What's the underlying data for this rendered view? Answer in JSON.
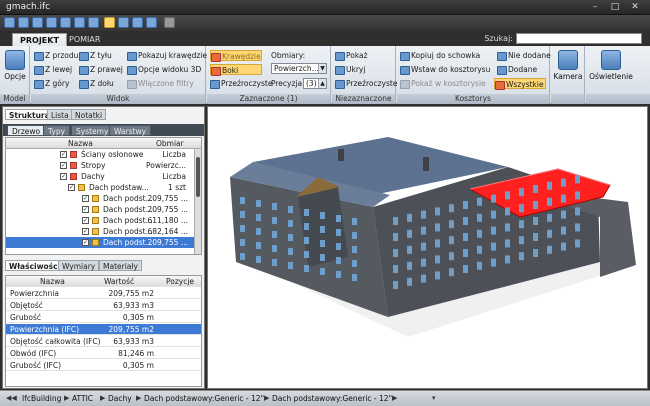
{
  "window": {
    "title": "gmach.ifc",
    "min": "–",
    "max": "□",
    "close": "✕"
  },
  "tabs": [
    "PROJEKT",
    "POMIAR"
  ],
  "search": {
    "label": "Szukaj:",
    "value": ""
  },
  "ribbon": {
    "model": {
      "button": "Opcje",
      "group": "Model"
    },
    "widok": {
      "group": "Widok",
      "items": [
        "Z przodu",
        "Z tyłu",
        "Z lewej",
        "Z prawej",
        "Z góry",
        "Z dołu"
      ],
      "edges": "Pokazuj krawędzie",
      "options3d": "Opcje widoku 3D",
      "filters": "Włączone filtry"
    },
    "zaznaczone": {
      "group": "Zaznaczone (1)",
      "items": [
        "Krawędzie",
        "Boki",
        "Przeźroczyste"
      ],
      "obmiary_label": "Obmiary:",
      "obmiary_value": "Powierzch...",
      "precyzja_label": "Precyzja",
      "precyzja_value": "(3)"
    },
    "niezaznaczone": {
      "group": "Niezaznaczone",
      "items": [
        "Pokaż",
        "Ukryj",
        "Przeźroczyste"
      ]
    },
    "kosztorys": {
      "group": "Kosztorys",
      "items": [
        "Kopiuj do schowka",
        "Wstaw do kosztorysu",
        "Pokaż w kosztorysie"
      ],
      "right": [
        "Nie dodane",
        "Dodane",
        "Wszystkie"
      ]
    },
    "camera": "Kamera",
    "lighting": "Oświetlenie"
  },
  "leftpane": {
    "tabs": [
      "Struktura",
      "Lista",
      "Notatki"
    ],
    "subtabs": [
      "Drzewo",
      "Typy",
      "Systemy",
      "Warstwy"
    ],
    "tree_headers": [
      "Nazwa",
      "Obmiar"
    ],
    "tree_rows": [
      {
        "name": "Ściany osłonowe",
        "value": "Liczba"
      },
      {
        "name": "Stropy",
        "value": "Powierzc..."
      },
      {
        "name": "Dachy",
        "value": "Liczba"
      },
      {
        "name": "Dach podstaw...",
        "value": "1 szt"
      },
      {
        "name": "Dach podst...",
        "value": "209,755 ..."
      },
      {
        "name": "Dach podst...",
        "value": "209,755 ..."
      },
      {
        "name": "Dach podst...",
        "value": "611,180 ..."
      },
      {
        "name": "Dach podst...",
        "value": "682,164 ..."
      },
      {
        "name": "Dach podst...",
        "value": "209,755 ..."
      }
    ],
    "props_tabs": [
      "Właściwości",
      "Wymiary",
      "Materiały"
    ],
    "props_headers": [
      "Nazwa",
      "Wartość",
      "Pozycje"
    ],
    "props_rows": [
      {
        "name": "Powierzchnia",
        "value": "209,755 m2"
      },
      {
        "name": "Objętość",
        "value": "63,933 m3"
      },
      {
        "name": "Grubość",
        "value": "0,305 m"
      },
      {
        "name": "Powierzchnia (IFC)",
        "value": "209,755 m2"
      },
      {
        "name": "Objętość całkowita (IFC)",
        "value": "63,933 m3"
      },
      {
        "name": "Obwód (IFC)",
        "value": "81,246 m"
      },
      {
        "name": "Grubość (IFC)",
        "value": "0,305 m"
      }
    ]
  },
  "status": {
    "crumbs": [
      "IfcBuilding",
      "ATTIC",
      "Dachy",
      "Dach podstawowy:Generic - 12\"",
      "Dach podstawowy:Generic - 12\""
    ]
  },
  "colors": {
    "selection": "#3d7ad6",
    "highlight_roof": "#ff2020",
    "building": "#5a5e64"
  }
}
